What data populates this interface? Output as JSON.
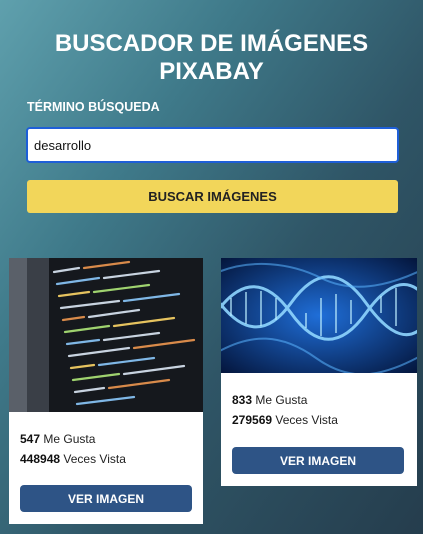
{
  "header": {
    "title": "BUSCADOR DE IMÁGENES PIXABAY"
  },
  "search": {
    "label": "TÉRMINO BÚSQUEDA",
    "value": "desarrollo",
    "button_label": "BUSCAR IMÁGENES"
  },
  "results": [
    {
      "image_subject": "code-on-screen",
      "likes_count": "547",
      "likes_label": "Me Gusta",
      "views_count": "448948",
      "views_label": "Veces Vista",
      "button_label": "VER IMAGEN"
    },
    {
      "image_subject": "dna-helix",
      "likes_count": "833",
      "likes_label": "Me Gusta",
      "views_count": "279569",
      "views_label": "Veces Vista",
      "button_label": "VER IMAGEN"
    }
  ],
  "colors": {
    "background_start": "#5fa0ad",
    "background_end": "#253d4d",
    "search_button": "#f2d65a",
    "view_button": "#2e5486",
    "input_border": "#1e5fd8"
  }
}
